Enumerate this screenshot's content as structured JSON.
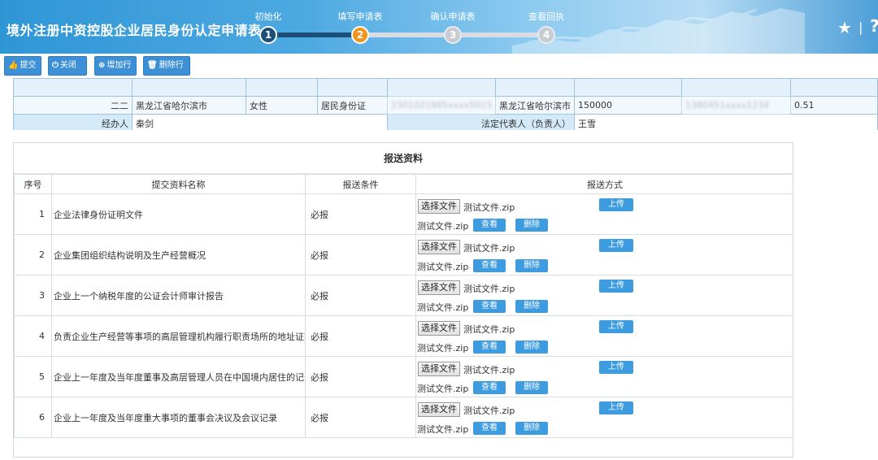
{
  "header": {
    "title": "境外注册中资控股企业居民身份认定申请表",
    "steps": [
      {
        "label": "初始化",
        "num": "1",
        "state": "done"
      },
      {
        "label": "填写申请表",
        "num": "2",
        "state": "active"
      },
      {
        "label": "确认申请表",
        "num": "3",
        "state": "todo"
      },
      {
        "label": "查看回执",
        "num": "4",
        "state": "todo"
      }
    ],
    "star_icon": "★",
    "separator": "|",
    "help_icon": "?"
  },
  "toolbar": {
    "submit": "提交",
    "close": "关闭",
    "add_row": "增加行",
    "delete_row": "删除行"
  },
  "applicant": {
    "row": {
      "index": "二二",
      "address": "黑龙江省哈尔滨市",
      "gender": "女性",
      "id_type": "居民身份证",
      "id_number": "2301021985xxxx5023",
      "address2": "黑龙江省哈尔滨市",
      "postcode": "150000",
      "phone": "1380451xxxx1234",
      "ratio": "0.51"
    },
    "agent_label": "经办人",
    "agent_name": "秦剑",
    "legal_rep_label": "法定代表人（负责人）",
    "legal_rep_name": "王雪"
  },
  "materials": {
    "title": "报送资料",
    "columns": [
      "序号",
      "提交资料名称",
      "报送条件",
      "报送方式"
    ],
    "choose_label": "选择文件",
    "upload_label": "上传",
    "view_label": "查看",
    "delete_label": "删除",
    "rows": [
      {
        "no": "1",
        "name": "企业法律身份证明文件",
        "cond": "必报",
        "file1": "测试文件.zip",
        "file2": "测试文件.zip"
      },
      {
        "no": "2",
        "name": "企业集团组织结构说明及生产经营概况",
        "cond": "必报",
        "file1": "测试文件.zip",
        "file2": "测试文件.zip"
      },
      {
        "no": "3",
        "name": "企业上一个纳税年度的公证会计师审计报告",
        "cond": "必报",
        "file1": "测试文件.zip",
        "file2": "测试文件.zip"
      },
      {
        "no": "4",
        "name": "负责企业生产经营等事项的高层管理机构履行职责场所的地址证明",
        "cond": "必报",
        "file1": "测试文件.zip",
        "file2": "测试文件.zip"
      },
      {
        "no": "5",
        "name": "企业上一年度及当年度董事及高层管理人员在中国境内居住的记录",
        "cond": "必报",
        "file1": "测试文件.zip",
        "file2": "测试文件.zip"
      },
      {
        "no": "6",
        "name": "企业上一年度及当年度重大事项的董事会决议及会议记录",
        "cond": "必报",
        "file1": "测试文件.zip",
        "file2": "测试文件.zip"
      }
    ]
  },
  "colors": {
    "header_blue": "#2f96d6",
    "active_step": "#f0951e",
    "done_step": "#1b4f7a",
    "button_blue": "#3d9be0",
    "label_bg": "#d4eaf8"
  }
}
